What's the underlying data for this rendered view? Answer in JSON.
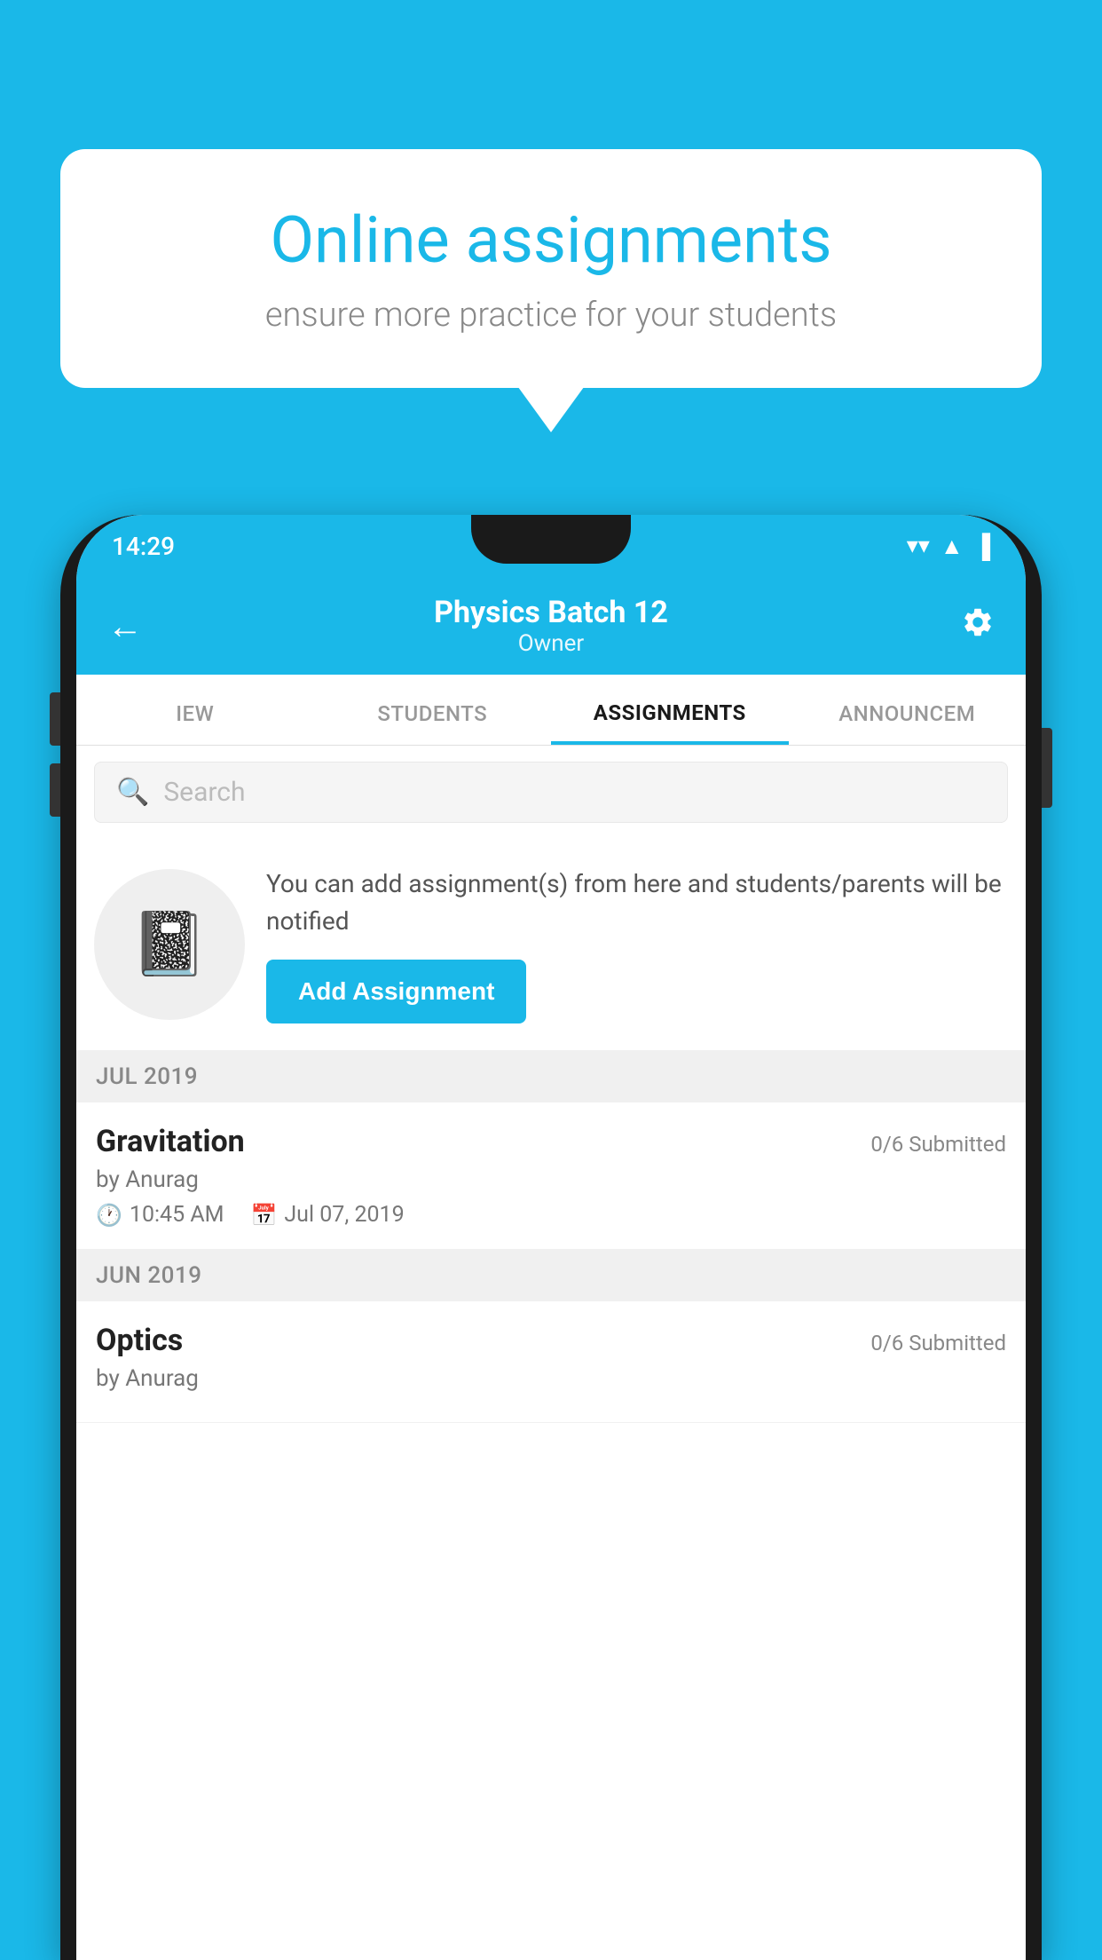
{
  "background_color": "#1ab8e8",
  "speech_bubble": {
    "title": "Online assignments",
    "subtitle": "ensure more practice for your students"
  },
  "phone": {
    "status_bar": {
      "time": "14:29",
      "wifi": "▼",
      "signal": "▲",
      "battery": "▐"
    },
    "header": {
      "title": "Physics Batch 12",
      "subtitle": "Owner",
      "back_label": "←",
      "settings_label": "⚙"
    },
    "tabs": [
      {
        "label": "IEW",
        "active": false
      },
      {
        "label": "STUDENTS",
        "active": false
      },
      {
        "label": "ASSIGNMENTS",
        "active": true
      },
      {
        "label": "ANNOUNCEM",
        "active": false
      }
    ],
    "search": {
      "placeholder": "Search"
    },
    "promo": {
      "text": "You can add assignment(s) from here and students/parents will be notified",
      "button_label": "Add Assignment"
    },
    "assignments": {
      "sections": [
        {
          "month": "JUL 2019",
          "items": [
            {
              "name": "Gravitation",
              "submitted": "0/6 Submitted",
              "author": "by Anurag",
              "time": "10:45 AM",
              "date": "Jul 07, 2019"
            }
          ]
        },
        {
          "month": "JUN 2019",
          "items": [
            {
              "name": "Optics",
              "submitted": "0/6 Submitted",
              "author": "by Anurag",
              "time": "",
              "date": ""
            }
          ]
        }
      ]
    }
  }
}
